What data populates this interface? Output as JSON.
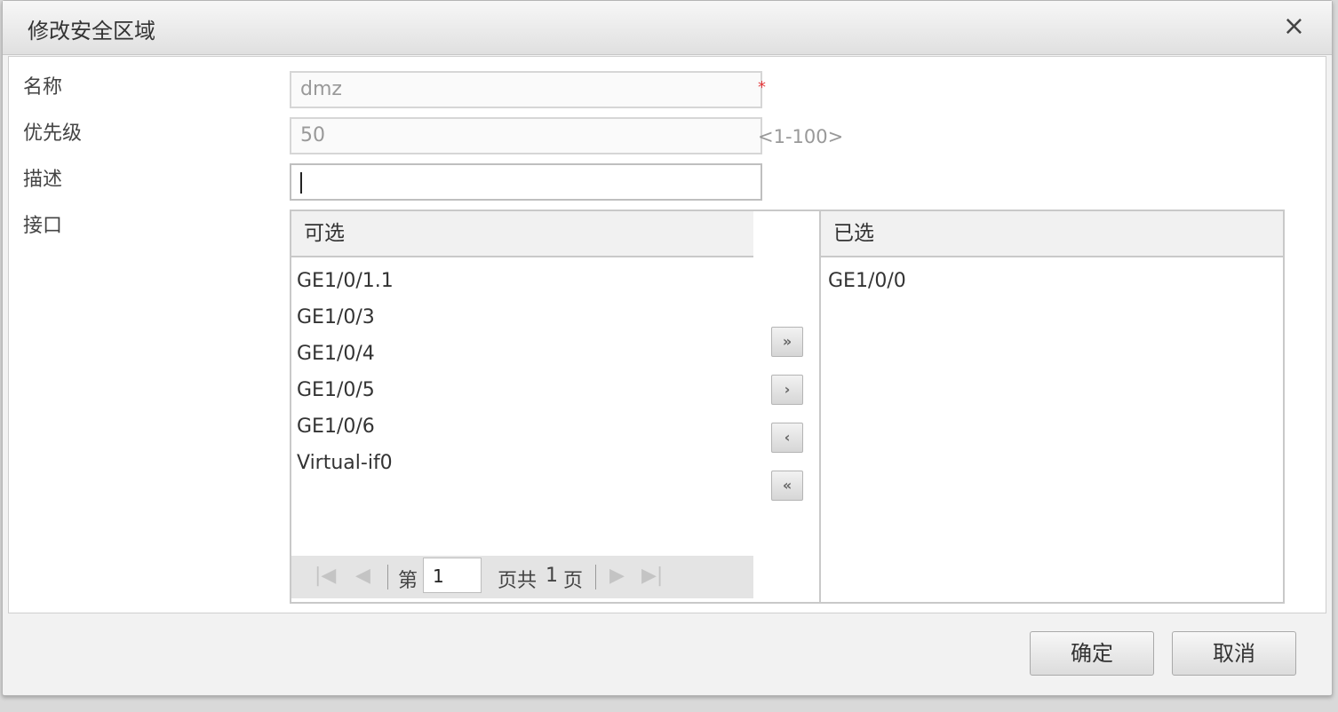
{
  "dialog": {
    "title": "修改安全区域",
    "close": "×"
  },
  "form": {
    "name_label": "名称",
    "name_value": "dmz",
    "required_mark": "*",
    "priority_label": "优先级",
    "priority_value": "50",
    "priority_hint": "<1-100>",
    "desc_label": "描述",
    "desc_value": "",
    "iface_label": "接口"
  },
  "transfer": {
    "available_title": "可选",
    "available": [
      "GE1/0/1.1",
      "GE1/0/3",
      "GE1/0/4",
      "GE1/0/5",
      "GE1/0/6",
      "Virtual-if0"
    ],
    "selected_title": "已选",
    "selected": [
      "GE1/0/0"
    ],
    "buttons": {
      "move_all_right": "»",
      "move_right": "›",
      "move_left": "‹",
      "move_all_left": "«"
    },
    "pager": {
      "first_icon": "first-page-icon",
      "prev_icon": "prev-page-icon",
      "next_icon": "next-page-icon",
      "last_icon": "last-page-icon",
      "page_prefix": "第",
      "page_value": "1",
      "page_suffix": "页共",
      "total_pages": "1",
      "total_suffix": "页"
    }
  },
  "footer": {
    "ok": "确定",
    "cancel": "取消"
  }
}
